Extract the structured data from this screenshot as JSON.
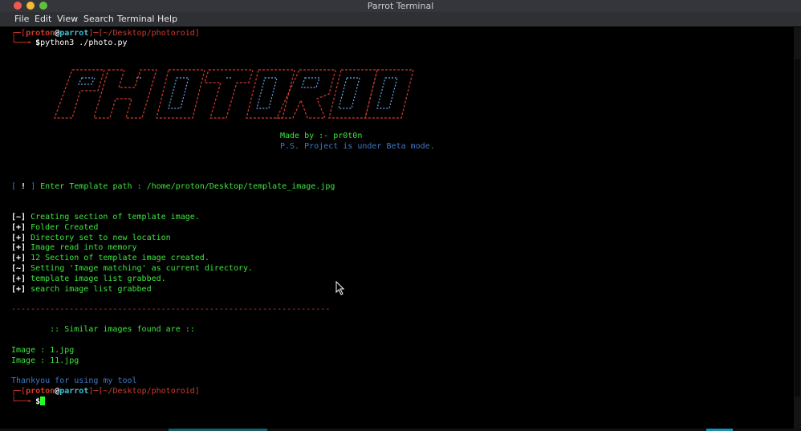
{
  "window": {
    "title": "Parrot Terminal"
  },
  "menu": {
    "file": "File",
    "edit": "Edit",
    "view": "View",
    "search": "Search",
    "terminal": "Terminal",
    "help": "Help"
  },
  "prompt1": {
    "user": "proton",
    "at": "@",
    "host": "parrot",
    "path": "~/Desktop/photoroid",
    "symbol": "$",
    "command": "python3 ./photo.py"
  },
  "banner": {
    "made_by": "Made by :- pr0t0n",
    "note": "P.S. Project is under Beta mode."
  },
  "input_prompt": {
    "text": " Enter Template path : /home/proton/Desktop/template_image.jpg"
  },
  "log": [
    {
      "tag": "[~]",
      "text": " Creating section of template image."
    },
    {
      "tag": "[+]",
      "text": " Folder Created"
    },
    {
      "tag": "[+]",
      "text": " Directory set to new location"
    },
    {
      "tag": "[+]",
      "text": " Image read into memory"
    },
    {
      "tag": "[+]",
      "text": " 12 Section of template image created."
    },
    {
      "tag": "[~]",
      "text": " Setting 'Image matching' as current directory."
    },
    {
      "tag": "[+]",
      "text": " template image list grabbed."
    },
    {
      "tag": "[+]",
      "text": " search image list grabbed"
    }
  ],
  "separator": "------------------------------------------------------------------",
  "results": {
    "header": "        :: Similar images found are ::",
    "items": [
      "Image : 1.jpg",
      "Image : 11.jpg"
    ]
  },
  "thanks": "Thankyou for using my tool",
  "prompt2": {
    "user": "proton",
    "at": "@",
    "host": "parrot",
    "path": "~/Desktop/photoroid",
    "symbol": "$"
  },
  "colors": {
    "prompt_red": "#d23b2d",
    "output_green": "#3ee53e",
    "accent_blue": "#2f80c9",
    "background": "#000000"
  }
}
